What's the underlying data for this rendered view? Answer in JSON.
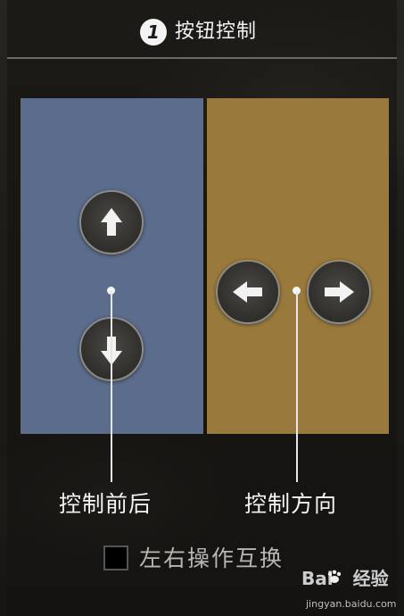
{
  "header": {
    "step_number": "1",
    "title": "按钮控制"
  },
  "zones": {
    "left": {
      "color": "#5c6c8c",
      "buttons": [
        "arrow-up-icon",
        "arrow-down-icon"
      ]
    },
    "right": {
      "color": "#9a7a3c",
      "buttons": [
        "arrow-left-icon",
        "arrow-right-icon"
      ]
    }
  },
  "labels": {
    "left": "控制前后",
    "right": "控制方向"
  },
  "options": {
    "swap_label": "左右操作互换",
    "swap_checked": false
  },
  "watermark": {
    "brand_a": "Bai",
    "brand_b": "经验",
    "url": "jingyan.baidu.com"
  }
}
